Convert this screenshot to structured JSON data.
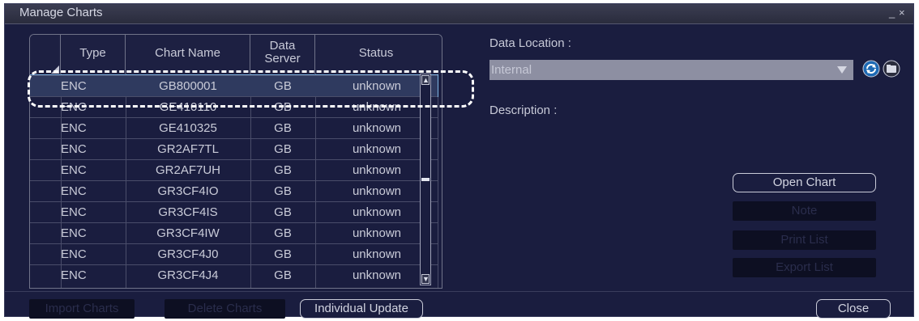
{
  "window": {
    "title": "Manage Charts",
    "controls": [
      "_",
      "×"
    ]
  },
  "table": {
    "columns": {
      "type": "Type",
      "name": "Chart Name",
      "server": "Data Server",
      "status": "Status"
    },
    "rows": [
      {
        "type": "ENC",
        "name": "GB800001",
        "server": "GB",
        "status": "unknown"
      },
      {
        "type": "ENC",
        "name": "GE410110",
        "server": "GB",
        "status": "unknown"
      },
      {
        "type": "ENC",
        "name": "GE410325",
        "server": "GB",
        "status": "unknown"
      },
      {
        "type": "ENC",
        "name": "GR2AF7TL",
        "server": "GB",
        "status": "unknown"
      },
      {
        "type": "ENC",
        "name": "GR2AF7UH",
        "server": "GB",
        "status": "unknown"
      },
      {
        "type": "ENC",
        "name": "GR3CF4IO",
        "server": "GB",
        "status": "unknown"
      },
      {
        "type": "ENC",
        "name": "GR3CF4IS",
        "server": "GB",
        "status": "unknown"
      },
      {
        "type": "ENC",
        "name": "GR3CF4IW",
        "server": "GB",
        "status": "unknown"
      },
      {
        "type": "ENC",
        "name": "GR3CF4J0",
        "server": "GB",
        "status": "unknown"
      },
      {
        "type": "ENC",
        "name": "GR3CF4J4",
        "server": "GB",
        "status": "unknown"
      }
    ]
  },
  "panel": {
    "data_location_label": "Data Location :",
    "data_location_value": "Internal",
    "description_label": "Description :"
  },
  "buttons": {
    "open_chart": "Open Chart",
    "note": "Note",
    "print_list": "Print List",
    "export_list": "Export List",
    "import_charts": "Import Charts",
    "delete_charts": "Delete Charts",
    "individual_update": "Individual Update",
    "close": "Close"
  },
  "icons": {
    "refresh": "refresh-icon",
    "folder": "folder-icon"
  },
  "colors": {
    "window_bg": "#1a1d3f",
    "selected_row": "#2f3a5f",
    "selection_outline": "#7fb4e3"
  }
}
